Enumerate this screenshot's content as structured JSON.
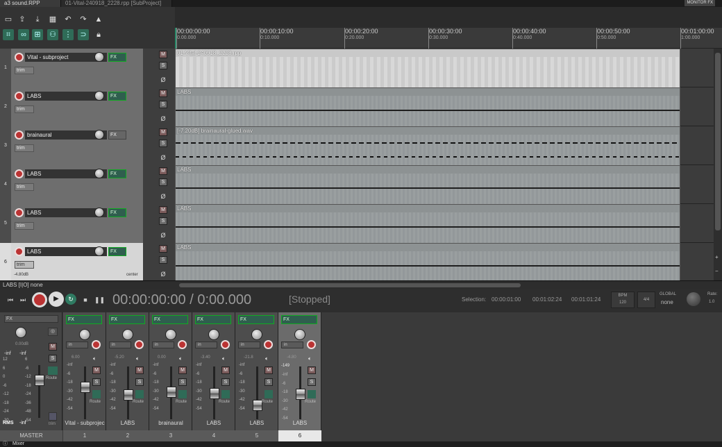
{
  "tabs": {
    "active": "a3 sound.RPP",
    "secondary": "01-Vital-240918_2228.rpp [SubProject]"
  },
  "monitor_fx": "MONITOR FX",
  "ruler": [
    {
      "t": "00:00:00:00",
      "b": "0.00.000"
    },
    {
      "t": "00:00:10:00",
      "b": "0:10.000"
    },
    {
      "t": "00:00:20:00",
      "b": "0:20.000"
    },
    {
      "t": "00:00:30:00",
      "b": "0:30.000"
    },
    {
      "t": "00:00:40:00",
      "b": "0:40.000"
    },
    {
      "t": "00:00:50:00",
      "b": "0:50.000"
    },
    {
      "t": "00:01:00:00",
      "b": "1:00.000"
    }
  ],
  "tracks": [
    {
      "num": "1",
      "name": "Vital - subproject",
      "item": "01-Vital-240918_2228.rpp",
      "fx_active": true
    },
    {
      "num": "2",
      "name": "LABS",
      "item": "LABS",
      "fx_active": true
    },
    {
      "num": "3",
      "name": "brainaural",
      "item": "[-7.20dB] brainaural-glued.wav",
      "fx_active": false
    },
    {
      "num": "4",
      "name": "LABS",
      "item": "LABS",
      "fx_active": true
    },
    {
      "num": "5",
      "name": "LABS",
      "item": "LABS",
      "fx_active": true
    },
    {
      "num": "6",
      "name": "LABS",
      "item": "LABS",
      "fx_active": true,
      "vol": "-4.80dB",
      "pan": "center"
    }
  ],
  "labels": {
    "fx": "FX",
    "trim": "trim",
    "mute": "M",
    "solo": "S",
    "phase": "Ø",
    "in": "in",
    "route": "Route",
    "rms": "RMS",
    "inf": "-inf"
  },
  "status_line": "LABS [I|O] none",
  "transport": {
    "time": "00:00:00:00 / 0:00.000",
    "state": "[Stopped]",
    "selection_label": "Selection:",
    "sel_start": "00:00:01:00",
    "sel_end": "00:01:02:24",
    "sel_length": "00:01:01:24",
    "bpm_label": "BPM",
    "bpm": "120",
    "timesig": "4/4",
    "global_label": "GLOBAL",
    "global_value": "none",
    "rate_label": "Rate:",
    "rate": "1.0"
  },
  "master": {
    "name": "MASTER",
    "vol": "0.00dB",
    "peak_l": "-inf",
    "peak_r": "-inf",
    "rms": "-inf",
    "scale": [
      "12",
      "6",
      "0",
      "-6",
      "-12",
      "-18",
      "-24",
      "-30",
      "-36",
      "-42",
      "-48",
      "-54"
    ],
    "route": "Route",
    "trim": "trim"
  },
  "mixer_scale": [
    "-inf",
    "-6",
    "-18",
    "-30",
    "-42",
    "-54"
  ],
  "strips": [
    {
      "num": "1",
      "name": "Vital - subprojec",
      "vol": "6.00",
      "fader": 0.72
    },
    {
      "num": "2",
      "name": "LABS",
      "vol": "-5.20",
      "fader": 0.55
    },
    {
      "num": "3",
      "name": "brainaural",
      "vol": "0.00",
      "fader": 0.62
    },
    {
      "num": "4",
      "name": "LABS",
      "vol": "-3.40",
      "fader": 0.58
    },
    {
      "num": "5",
      "name": "LABS",
      "vol": "-21.8",
      "fader": 0.35
    },
    {
      "num": "6",
      "name": "LABS",
      "vol": "-4.80",
      "peak": "-149",
      "fader": 0.57,
      "selected": true
    }
  ],
  "bottom": {
    "label": "Mixer"
  }
}
